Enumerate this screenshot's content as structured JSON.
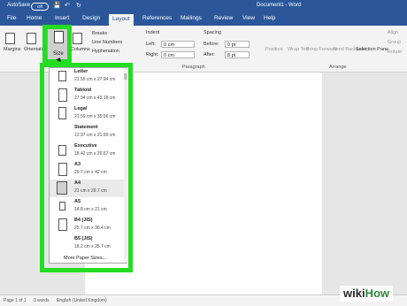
{
  "titlebar": {
    "autosave_label": "AutoSave",
    "autosave_state": "Off",
    "doc_title": "Document1 - Word"
  },
  "tabs": [
    "File",
    "Home",
    "Insert",
    "Design",
    "Layout",
    "References",
    "Mailings",
    "Review",
    "View",
    "Help"
  ],
  "active_tab": "Layout",
  "ribbon": {
    "margins": "Margins",
    "orientation": "Orientation",
    "size": "Size",
    "columns": "Columns",
    "breaks": "Breaks",
    "line_numbers": "Line Numbers",
    "hyphenation": "Hyphenation",
    "indent_label": "Indent",
    "indent_left_label": "Left:",
    "indent_left_value": "0 cm",
    "indent_right_label": "Right:",
    "indent_right_value": "0 cm",
    "spacing_label": "Spacing",
    "spacing_before_label": "Before:",
    "spacing_before_value": "0 pt",
    "spacing_after_label": "After:",
    "spacing_after_value": "8 pt",
    "paragraph_group": "Paragraph",
    "position": "Position",
    "wrap_text": "Wrap Text",
    "bring_forward": "Bring Forward",
    "send_backward": "Send Backward",
    "selection_pane": "Selection Pane",
    "align": "Align",
    "group": "Group",
    "rotate": "Rotate",
    "arrange_group": "Arrange"
  },
  "size_menu": {
    "items": [
      {
        "name": "Letter",
        "dims": "21.59 cm x 27.94 cm",
        "selected": false
      },
      {
        "name": "Tabloid",
        "dims": "27.94 cm x 43.18 cm",
        "selected": false
      },
      {
        "name": "Legal",
        "dims": "21.59 cm x 35.56 cm",
        "selected": false
      },
      {
        "name": "Statement",
        "dims": "13.97 cm x 21.59 cm",
        "selected": false
      },
      {
        "name": "Executive",
        "dims": "18.42 cm x 26.67 cm",
        "selected": false
      },
      {
        "name": "A3",
        "dims": "29.7 cm x 42 cm",
        "selected": false
      },
      {
        "name": "A4",
        "dims": "21 cm x 29.7 cm",
        "selected": true
      },
      {
        "name": "A5",
        "dims": "14.8 cm x 21 cm",
        "selected": false
      },
      {
        "name": "B4 (JIS)",
        "dims": "25.7 cm x 36.4 cm",
        "selected": false
      },
      {
        "name": "B5 (JIS)",
        "dims": "18.2 cm x 25.7 cm",
        "selected": false
      }
    ],
    "more_label": "More Paper Sizes..."
  },
  "statusbar": {
    "page": "Page 1 of 1",
    "words": "0 words",
    "language": "English (United Kingdom)"
  },
  "watermark": {
    "wiki": "wiki",
    "how": "How"
  },
  "colors": {
    "word_blue": "#2b579a",
    "highlight_green": "#22dd22"
  }
}
